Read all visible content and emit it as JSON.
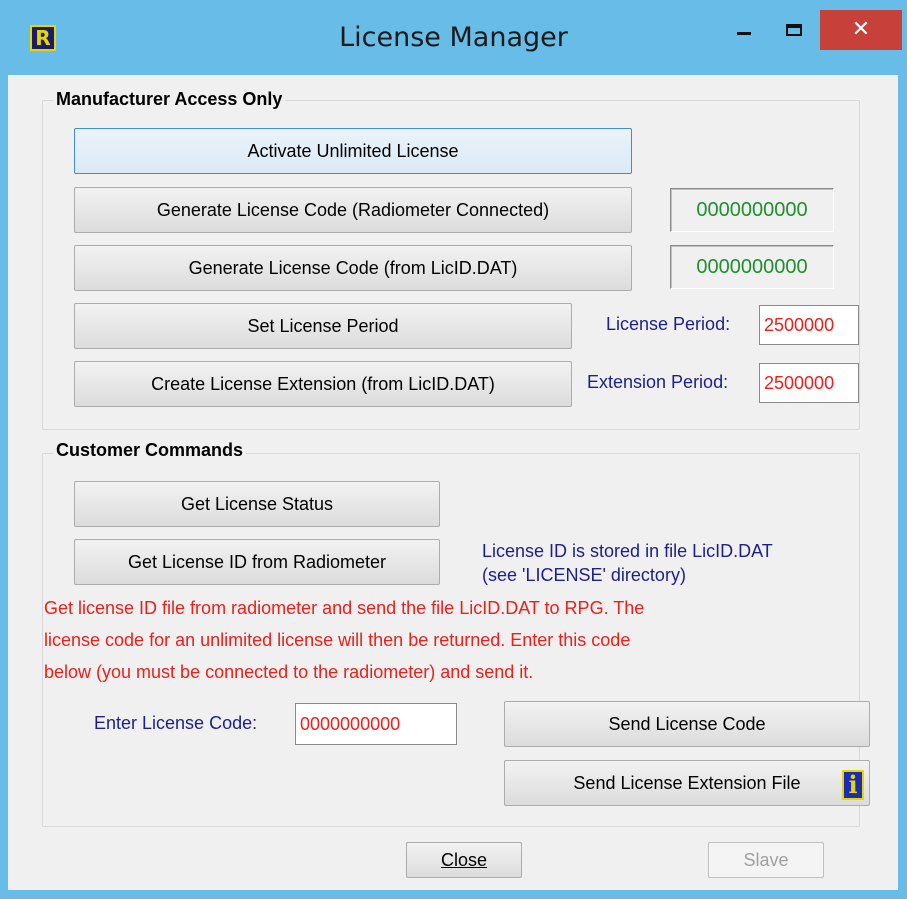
{
  "window": {
    "title": "License Manager",
    "app_icon": "R",
    "minimize": "minimize-icon",
    "maximize": "maximize-icon",
    "close": "✕"
  },
  "manufacturer": {
    "group_title": "Manufacturer Access Only",
    "activate_unlimited": "Activate Unlimited License",
    "generate_connected": "Generate License Code (Radiometer Connected)",
    "code_connected": "0000000000",
    "generate_from_file": "Generate License Code (from LicID.DAT)",
    "code_from_file": "0000000000",
    "set_period": "Set License Period",
    "license_period_label": "License Period:",
    "license_period_value": "2500000",
    "create_extension": "Create License Extension (from LicID.DAT)",
    "extension_period_label": "Extension Period:",
    "extension_period_value": "2500000"
  },
  "customer": {
    "group_title": "Customer Commands",
    "get_status": "Get License Status",
    "get_id": "Get License ID from Radiometer",
    "id_note_line1": "License ID is stored in file LicID.DAT",
    "id_note_line2": "(see 'LICENSE' directory)",
    "instructions_line1": "Get license ID file from radiometer and send the file LicID.DAT to RPG.  The",
    "instructions_line2": "license code for an unlimited license will then be returned. Enter this code",
    "instructions_line3": "below (you must be connected to the radiometer) and send it.",
    "enter_code_label": "Enter License Code:",
    "enter_code_value": "0000000000",
    "send_code": "Send License Code",
    "send_extension": "Send License Extension File"
  },
  "footer": {
    "close": "Close",
    "slave": "Slave",
    "info_icon": "i"
  },
  "colors": {
    "titlebar": "#67bde7",
    "close_button": "#c7403a",
    "code_green": "#1f8f2f",
    "value_red": "#e8211d",
    "label_blue": "#1e1e8c"
  }
}
